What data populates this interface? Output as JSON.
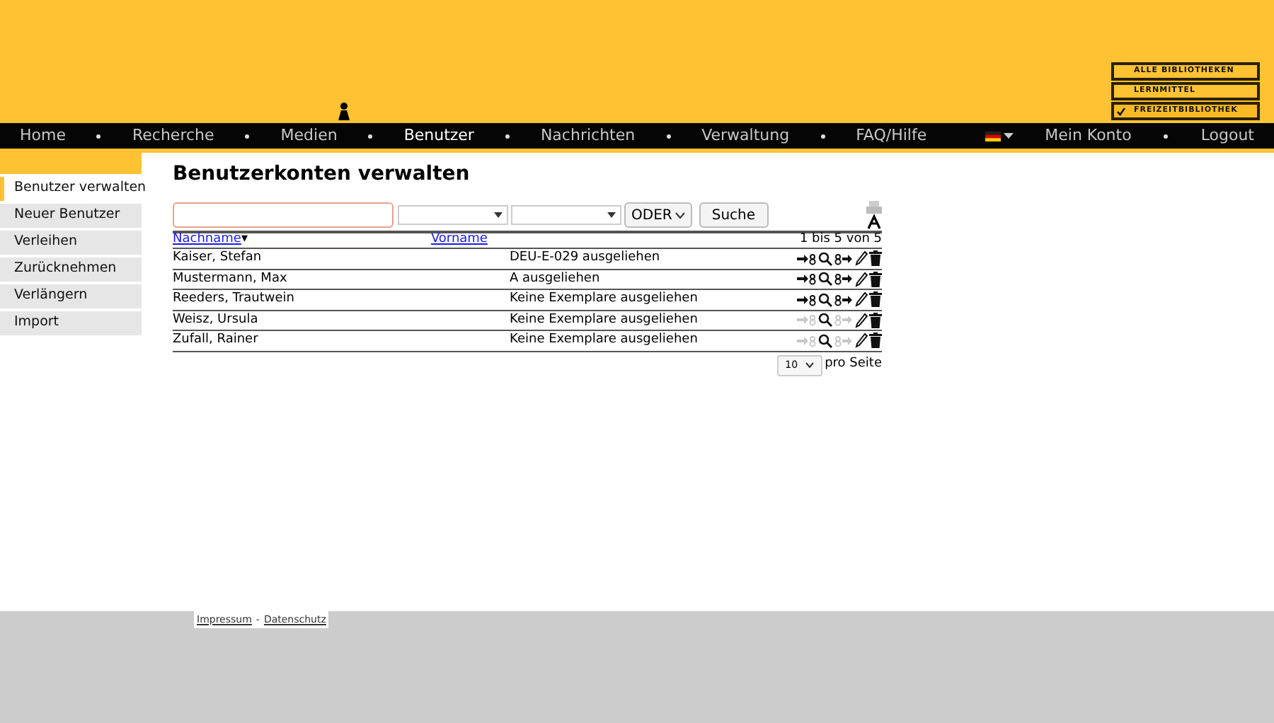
{
  "libraries": [
    {
      "label": "ALLE BIBLIOTHEKEN",
      "selected": false
    },
    {
      "label": "LERNMITTEL",
      "selected": false
    },
    {
      "label": "FREIZEITBIBLIOTHEK",
      "selected": true
    }
  ],
  "nav": {
    "items": [
      {
        "label": "Home",
        "selected": false
      },
      {
        "label": "Recherche",
        "selected": false
      },
      {
        "label": "Medien",
        "selected": false
      },
      {
        "label": "Benutzer",
        "selected": true
      },
      {
        "label": "Nachrichten",
        "selected": false
      },
      {
        "label": "Verwaltung",
        "selected": false
      },
      {
        "label": "FAQ/Hilfe",
        "selected": false
      }
    ],
    "right": [
      "Mein Konto",
      "Logout"
    ]
  },
  "sidebar": {
    "items": [
      {
        "label": "Benutzer verwalten",
        "selected": true
      },
      {
        "label": "Neuer Benutzer",
        "selected": false
      },
      {
        "label": "Verleihen",
        "selected": false
      },
      {
        "label": "Zurücknehmen",
        "selected": false
      },
      {
        "label": "Verlängern",
        "selected": false
      },
      {
        "label": "Import",
        "selected": false
      }
    ]
  },
  "title": "Benutzerkonten verwalten",
  "search": {
    "operator": "ODER",
    "button": "Suche"
  },
  "table": {
    "columns": [
      "Nachname",
      "Vorname"
    ],
    "sort_mark": "▾",
    "range": "1 bis 5 von 5",
    "rows": [
      {
        "name": "Kaiser, Stefan",
        "status": "DEU-E-029 ausgeliehen",
        "lend_enabled": true
      },
      {
        "name": "Mustermann, Max",
        "status": "A ausgeliehen",
        "lend_enabled": true
      },
      {
        "name": "Reeders, Trautwein",
        "status": "Keine Exemplare ausgeliehen",
        "lend_enabled": true
      },
      {
        "name": "Weisz, Ursula",
        "status": "Keine Exemplare ausgeliehen",
        "lend_enabled": false
      },
      {
        "name": "Zufall, Rainer",
        "status": "Keine Exemplare ausgeliehen",
        "lend_enabled": false
      }
    ]
  },
  "pagination": {
    "page_size": "10",
    "label": "pro Seite"
  },
  "footer": {
    "links": [
      "Impressum",
      "Datenschutz"
    ],
    "separator": "-"
  }
}
